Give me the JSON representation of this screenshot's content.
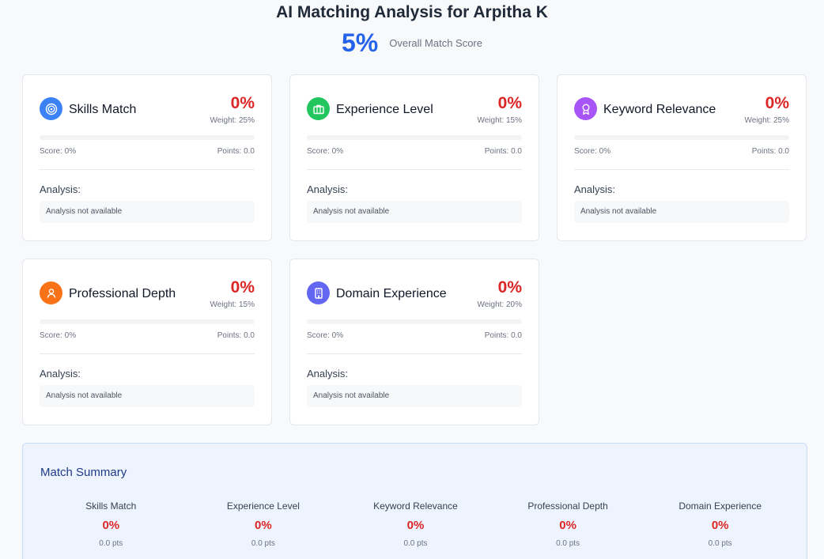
{
  "title": "AI Matching Analysis for Arpitha K",
  "overall": {
    "value": "5%",
    "label": "Overall Match Score"
  },
  "analysis_label": "Analysis:",
  "cards": [
    {
      "name": "Skills Match",
      "icon": "target-icon",
      "color": "#3b82f6",
      "pct": "0%",
      "weight": "Weight: 25%",
      "score": "Score: 0%",
      "points": "Points: 0.0",
      "analysis": "Analysis not available",
      "fill": 0
    },
    {
      "name": "Experience Level",
      "icon": "briefcase-icon",
      "color": "#22c55e",
      "pct": "0%",
      "weight": "Weight: 15%",
      "score": "Score: 0%",
      "points": "Points: 0.0",
      "analysis": "Analysis not available",
      "fill": 0
    },
    {
      "name": "Keyword Relevance",
      "icon": "award-icon",
      "color": "#a855f7",
      "pct": "0%",
      "weight": "Weight: 25%",
      "score": "Score: 0%",
      "points": "Points: 0.0",
      "analysis": "Analysis not available",
      "fill": 0
    },
    {
      "name": "Professional Depth",
      "icon": "user-icon",
      "color": "#f97316",
      "pct": "0%",
      "weight": "Weight: 15%",
      "score": "Score: 0%",
      "points": "Points: 0.0",
      "analysis": "Analysis not available",
      "fill": 0
    },
    {
      "name": "Domain Experience",
      "icon": "building-icon",
      "color": "#6366f1",
      "pct": "0%",
      "weight": "Weight: 20%",
      "score": "Score: 0%",
      "points": "Points: 0.0",
      "analysis": "Analysis not available",
      "fill": 0
    }
  ],
  "summary": {
    "title": "Match Summary",
    "items": [
      {
        "name": "Skills Match",
        "pct": "0%",
        "pts": "0.0 pts"
      },
      {
        "name": "Experience Level",
        "pct": "0%",
        "pts": "0.0 pts"
      },
      {
        "name": "Keyword Relevance",
        "pct": "0%",
        "pts": "0.0 pts"
      },
      {
        "name": "Professional Depth",
        "pct": "0%",
        "pts": "0.0 pts"
      },
      {
        "name": "Domain Experience",
        "pct": "0%",
        "pts": "0.0 pts"
      }
    ]
  }
}
